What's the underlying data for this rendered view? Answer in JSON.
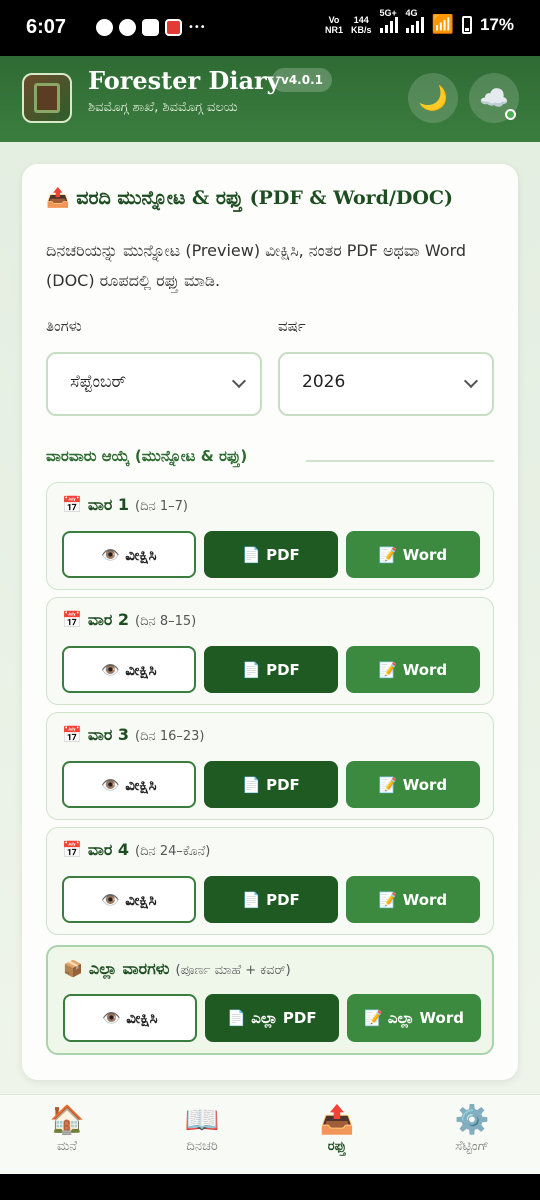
{
  "status_bar": {
    "time": "6:07",
    "net_label_top": "Vo",
    "net_label_bottom": "NR1",
    "speed_value": "144",
    "speed_unit": "KB/s",
    "signal_1": "5G+",
    "signal_2": "4G",
    "battery": "17%"
  },
  "header": {
    "title": "Forester Diary",
    "version": "v4.0.1",
    "subtitle": "ಶಿವಮೊಗ್ಗ ಶಾಖೆ, ಶಿವಮೊಗ್ಗ ವಲಯ",
    "theme_icon": "🌙",
    "sync_icon": "☁️"
  },
  "card": {
    "icon": "📤",
    "title": "ವರದಿ ಮುನ್ನೋಟ & ರಫ್ತು (PDF & Word/DOC)",
    "description": "ದಿನಚರಿಯನ್ನು ಮುನ್ನೋಟ (Preview) ವೀಕ್ಷಿಸಿ, ನಂತರ PDF ಅಥವಾ Word (DOC) ರೂಪದಲ್ಲಿ ರಫ್ತು ಮಾಡಿ.",
    "month_label": "ತಿಂಗಳು",
    "month_value": "ಸೆಪ್ಟೆಂಬರ್",
    "year_label": "ವರ್ಷ",
    "year_value": "2026",
    "section_heading": "ವಾರವಾರು ಆಯ್ಕೆ (ಮುನ್ನೋಟ & ರಫ್ತು)"
  },
  "weeks": [
    {
      "icon": "📅",
      "name": "ವಾರ 1",
      "range": "(ದಿನ 1–7)",
      "view": "👁️ ವೀಕ್ಷಿಸಿ",
      "pdf": "📄 PDF",
      "word": "📝 Word"
    },
    {
      "icon": "📅",
      "name": "ವಾರ 2",
      "range": "(ದಿನ 8–15)",
      "view": "👁️ ವೀಕ್ಷಿಸಿ",
      "pdf": "📄 PDF",
      "word": "📝 Word"
    },
    {
      "icon": "📅",
      "name": "ವಾರ 3",
      "range": "(ದಿನ 16–23)",
      "view": "👁️ ವೀಕ್ಷಿಸಿ",
      "pdf": "📄 PDF",
      "word": "📝 Word"
    },
    {
      "icon": "📅",
      "name": "ವಾರ 4",
      "range": "(ದಿನ 24–ಕೊನೆ)",
      "view": "👁️ ವೀಕ್ಷಿಸಿ",
      "pdf": "📄 PDF",
      "word": "📝 Word"
    }
  ],
  "all_weeks": {
    "icon": "📦",
    "name": "ಎಲ್ಲಾ ವಾರಗಳು",
    "range": "(ಪೂರ್ಣ ಮಾಹೆ + ಕವರ್)",
    "view": "👁️ ವೀಕ್ಷಿಸಿ",
    "pdf": "📄 ಎಲ್ಲಾ PDF",
    "word": "📝 ಎಲ್ಲಾ Word"
  },
  "nav": [
    {
      "icon": "🏠",
      "label": "ಮನೆ"
    },
    {
      "icon": "📖",
      "label": "ದಿನಚರಿ"
    },
    {
      "icon": "📤",
      "label": "ರಫ್ತು"
    },
    {
      "icon": "⚙️",
      "label": "ಸೆಟ್ಟಿಂಗ್"
    }
  ],
  "colors": {
    "primary": "#2f6b34",
    "pdf_button": "#1f5a23",
    "word_button": "#3b8a3f",
    "online": "#4caf50"
  }
}
